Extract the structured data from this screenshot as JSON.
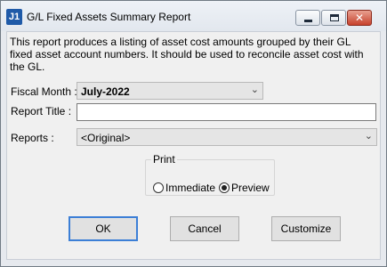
{
  "window": {
    "icon_text": "J1",
    "title": "G/L Fixed Assets Summary Report",
    "controls": {
      "minimize": "",
      "maximize": "",
      "close": "✕"
    }
  },
  "description": "This report produces a listing of asset cost amounts grouped by their GL fixed asset account numbers.  It should be used to reconcile asset cost with the GL.",
  "form": {
    "fiscal_month": {
      "label": "Fiscal Month :",
      "value": "July-2022"
    },
    "report_title": {
      "label": "Report Title :",
      "value": ""
    },
    "reports": {
      "label": "Reports :",
      "value": "<Original>"
    }
  },
  "print": {
    "legend": "Print",
    "options": [
      {
        "label": "Immediate",
        "selected": false
      },
      {
        "label": "Preview",
        "selected": true
      }
    ]
  },
  "buttons": {
    "ok": "OK",
    "cancel": "Cancel",
    "customize": "Customize"
  },
  "icons": {
    "dropdown": "chevron-down-icon"
  }
}
